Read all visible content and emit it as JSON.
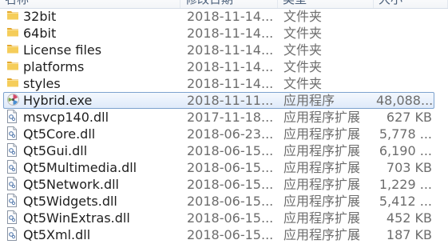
{
  "columns": {
    "name": "名称",
    "date": "修改日期",
    "type": "类型",
    "size": "大小"
  },
  "files": [
    {
      "name": "32bit",
      "date": "2018-11-14...",
      "type": "文件夹",
      "size": "",
      "icon": "folder-icon"
    },
    {
      "name": "64bit",
      "date": "2018-11-14...",
      "type": "文件夹",
      "size": "",
      "icon": "folder-icon"
    },
    {
      "name": "License files",
      "date": "2018-11-14...",
      "type": "文件夹",
      "size": "",
      "icon": "folder-icon"
    },
    {
      "name": "platforms",
      "date": "2018-11-14...",
      "type": "文件夹",
      "size": "",
      "icon": "folder-icon"
    },
    {
      "name": "styles",
      "date": "2018-11-14...",
      "type": "文件夹",
      "size": "",
      "icon": "folder-icon"
    },
    {
      "name": "Hybrid.exe",
      "date": "2018-11-11...",
      "type": "应用程序",
      "size": "48,088...",
      "icon": "app-icon",
      "selected": true
    },
    {
      "name": "msvcp140.dll",
      "date": "2017-11-18...",
      "type": "应用程序扩展",
      "size": "627 KB",
      "icon": "dll-file-icon"
    },
    {
      "name": "Qt5Core.dll",
      "date": "2018-06-23...",
      "type": "应用程序扩展",
      "size": "5,778 ...",
      "icon": "dll-file-icon"
    },
    {
      "name": "Qt5Gui.dll",
      "date": "2018-06-15...",
      "type": "应用程序扩展",
      "size": "6,190 ...",
      "icon": "dll-file-icon"
    },
    {
      "name": "Qt5Multimedia.dll",
      "date": "2018-06-15...",
      "type": "应用程序扩展",
      "size": "703 KB",
      "icon": "dll-file-icon"
    },
    {
      "name": "Qt5Network.dll",
      "date": "2018-06-15...",
      "type": "应用程序扩展",
      "size": "1,229 ...",
      "icon": "dll-file-icon"
    },
    {
      "name": "Qt5Widgets.dll",
      "date": "2018-06-15...",
      "type": "应用程序扩展",
      "size": "5,412 ...",
      "icon": "dll-file-icon"
    },
    {
      "name": "Qt5WinExtras.dll",
      "date": "2018-06-15...",
      "type": "应用程序扩展",
      "size": "452 KB",
      "icon": "dll-file-icon"
    },
    {
      "name": "Qt5Xml.dll",
      "date": "2018-06-15...",
      "type": "应用程序扩展",
      "size": "187 KB",
      "icon": "dll-file-icon"
    }
  ],
  "colors": {
    "folder": "#e8b43a",
    "selection_border": "#7da2ce",
    "selection_fill": "#dfeafa"
  }
}
